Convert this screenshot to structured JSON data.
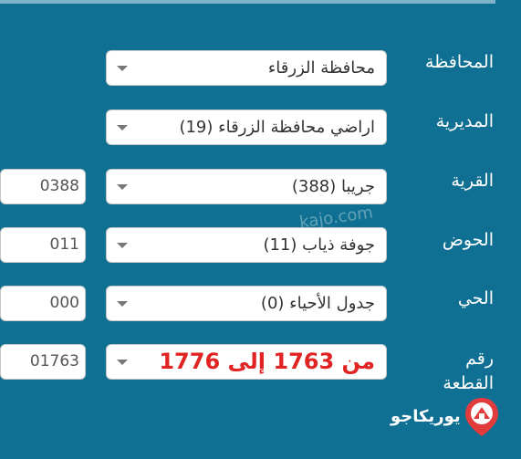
{
  "form": {
    "governorate": {
      "label": "المحافظة",
      "value": "محافظة الزرقاء"
    },
    "directorate": {
      "label": "المديرية",
      "value": "اراضي محافظة الزرقاء (19)"
    },
    "village": {
      "label": "القرية",
      "value": "جريبا (388)",
      "code": "0388"
    },
    "basin": {
      "label": "الحوض",
      "value": "جوفة ذياب (11)",
      "code": "011"
    },
    "neighborhood": {
      "label": "الحي",
      "value": "جدول الأحياء (0)",
      "code": "000"
    },
    "plot": {
      "label_line1": "رقم",
      "label_line2": "القطعة",
      "value": "من 1763 إلى 1776",
      "code": "01763"
    }
  },
  "watermark": "kajo.com",
  "brand": {
    "name": "يوريكاجو",
    "icon": "map-pin-icon"
  },
  "colors": {
    "background": "#0f7093",
    "range_text": "#e02424"
  }
}
